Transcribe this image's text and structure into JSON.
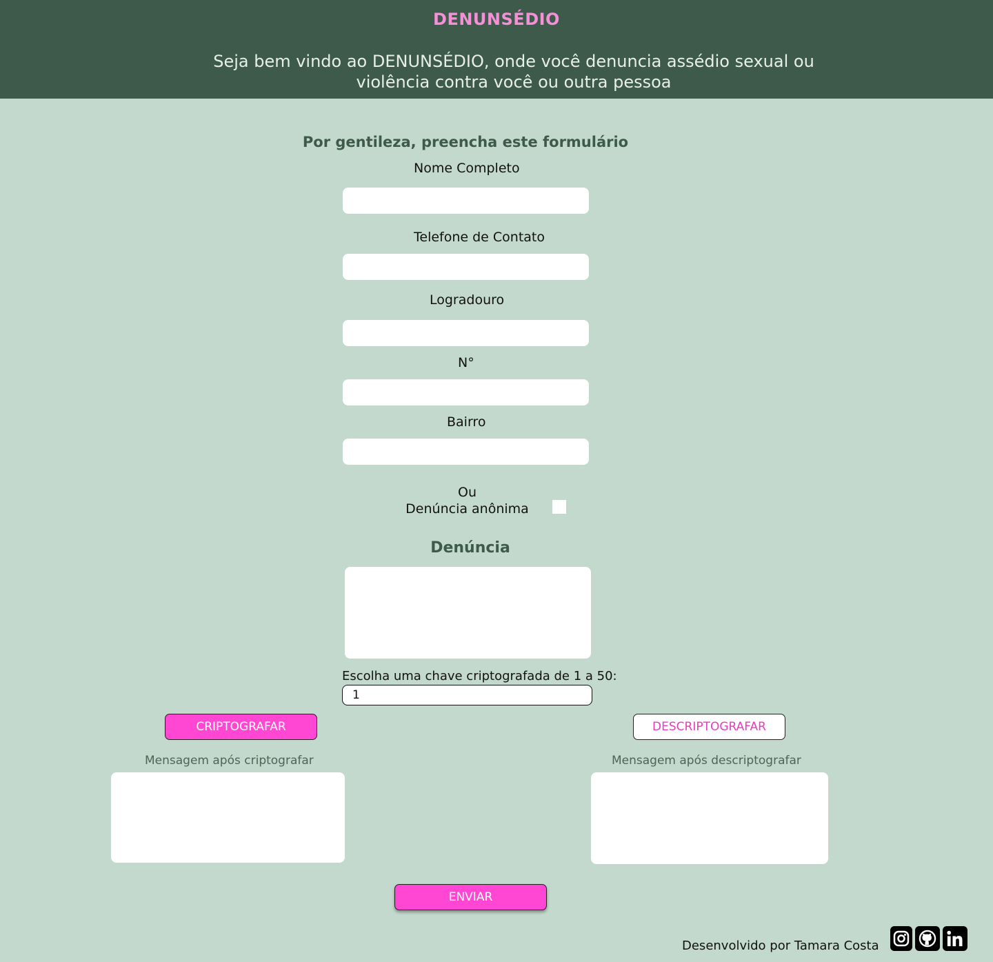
{
  "header": {
    "brand": "DENUNSÉDIO",
    "welcome": "Seja bem vindo ao DENUNSÉDIO, onde você denuncia assédio sexual ou violência contra você ou outra pessoa"
  },
  "form": {
    "title": "Por gentileza, preencha este formulário",
    "name_label": "Nome Completo",
    "phone_label": "Telefone de Contato",
    "street_label": "Logradouro",
    "number_label": "N°",
    "district_label": "Bairro",
    "anon_or": "Ou",
    "anon_label": "Denúncia anônima",
    "report_title": "Denúncia",
    "key_label": "Escolha uma chave criptografada de 1 a 50:",
    "key_value": "1"
  },
  "actions": {
    "encrypt": "CRIPTOGRAFAR",
    "decrypt": "DESCRIPTOGRAFAR",
    "encrypted_label": "Mensagem após criptografar",
    "decrypted_label": "Mensagem após descriptografar",
    "send": "ENVIAR"
  },
  "footer": {
    "credit": "Desenvolvido por Tamara Costa",
    "icons": [
      "instagram-icon",
      "github-icon",
      "linkedin-icon"
    ]
  },
  "colors": {
    "header_bg": "#3d5a4a",
    "page_bg": "#c4d9cd",
    "brand": "#f58fd6",
    "accent_button": "#ff47d3"
  }
}
